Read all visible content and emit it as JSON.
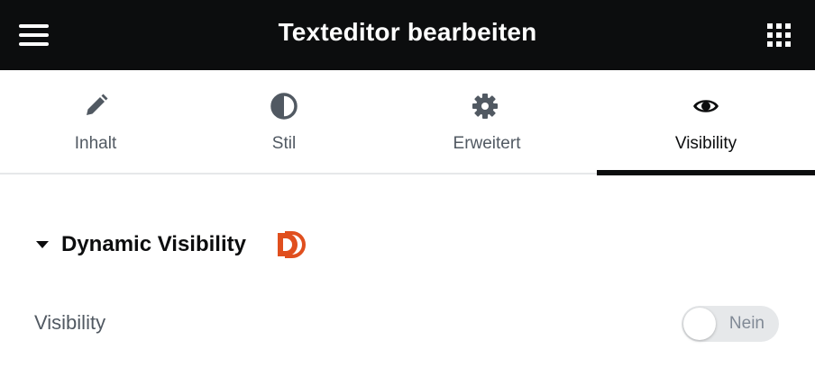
{
  "header": {
    "title": "Texteditor bearbeiten",
    "menu_icon": "hamburger-menu-icon",
    "apps_icon": "grid-apps-icon",
    "background": "#0c0d0e"
  },
  "tabs": [
    {
      "label": "Inhalt",
      "icon": "pencil-icon",
      "active": false
    },
    {
      "label": "Stil",
      "icon": "half-circle-contrast-icon",
      "active": false
    },
    {
      "label": "Erweitert",
      "icon": "gear-icon",
      "active": false
    },
    {
      "label": "Visibility",
      "icon": "eye-icon",
      "active": true
    }
  ],
  "section": {
    "title": "Dynamic Visibility",
    "expanded": true,
    "logo_icon": "dynamic-content-d-logo-icon",
    "logo_color": "#e04f1e"
  },
  "visibility_field": {
    "label": "Visibility",
    "toggle_text": "Nein",
    "toggle_on": false
  }
}
